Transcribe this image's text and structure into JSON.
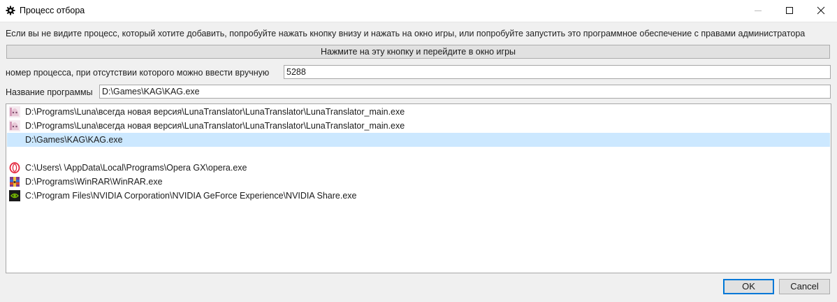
{
  "window": {
    "title": "Процесс отбора",
    "app_icon": "gear-icon"
  },
  "info_text": "Если вы не видите процесс, который хотите добавить, попробуйте нажать кнопку внизу и нажать на окно игры, или попробуйте запустить это программное обеспечение с правами администратора",
  "pick_button_label": "Нажмите на эту кнопку и перейдите в окно игры",
  "pid_field": {
    "label": "номер процесса, при отсутствии которого можно ввести вручную",
    "value": "5288"
  },
  "program_field": {
    "label": "Название программы",
    "value": "D:\\Games\\KAG\\KAG.exe"
  },
  "process_list": [
    {
      "path": "D:\\Programs\\Luna\\всегда новая версия\\LunaTranslator\\LunaTranslator\\LunaTranslator_main.exe",
      "icon": "luna-translator-icon",
      "selected": false
    },
    {
      "path": "D:\\Programs\\Luna\\всегда новая версия\\LunaTranslator\\LunaTranslator\\LunaTranslator_main.exe",
      "icon": "luna-translator-icon",
      "selected": false
    },
    {
      "path": "D:\\Games\\KAG\\KAG.exe",
      "icon": "",
      "selected": true
    },
    {
      "path": "",
      "icon": "",
      "selected": false
    },
    {
      "path": "C:\\Users\\             \\AppData\\Local\\Programs\\Opera GX\\opera.exe",
      "icon": "opera-icon",
      "selected": false
    },
    {
      "path": "D:\\Programs\\WinRAR\\WinRAR.exe",
      "icon": "winrar-icon",
      "selected": false
    },
    {
      "path": "C:\\Program Files\\NVIDIA Corporation\\NVIDIA GeForce Experience\\NVIDIA Share.exe",
      "icon": "nvidia-icon",
      "selected": false
    }
  ],
  "buttons": {
    "ok": "OK",
    "cancel": "Cancel"
  },
  "colors": {
    "selection": "#cce8ff",
    "default_button_border": "#0078d7",
    "opera_red": "#e3243b",
    "nvidia_green": "#76b900"
  }
}
